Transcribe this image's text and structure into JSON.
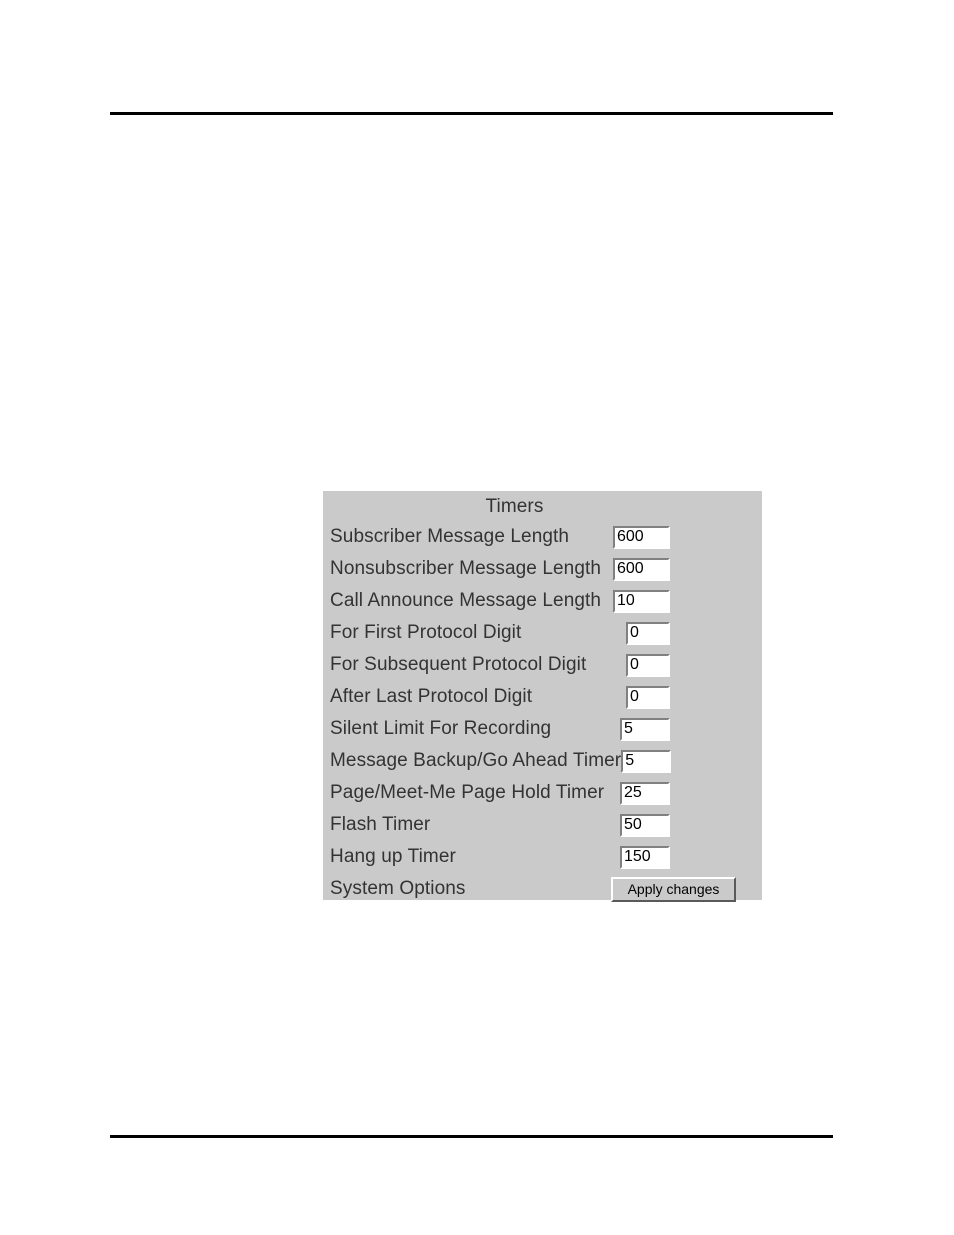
{
  "page": {
    "rules": {
      "top": true,
      "bottom": true
    }
  },
  "panel": {
    "title": "Timers",
    "rows": [
      {
        "label": "Subscriber Message Length",
        "value": "600",
        "width": "wide"
      },
      {
        "label": "Nonsubscriber Message Length",
        "value": "600",
        "width": "wide"
      },
      {
        "label": "Call Announce Message Length",
        "value": "10",
        "width": "wide"
      },
      {
        "label": "For First Protocol Digit",
        "value": "0",
        "width": "narrow"
      },
      {
        "label": "For Subsequent Protocol Digit",
        "value": "0",
        "width": "narrow"
      },
      {
        "label": "After Last Protocol Digit",
        "value": "0",
        "width": "narrow"
      },
      {
        "label": "Silent Limit For Recording",
        "value": "5",
        "width": "mid"
      },
      {
        "label": "Message Backup/Go Ahead Timer",
        "value": "5",
        "width": "mid"
      },
      {
        "label": "Page/Meet-Me Page Hold Timer",
        "value": "25",
        "width": "mid"
      },
      {
        "label": "Flash Timer",
        "value": "50",
        "width": "mid"
      },
      {
        "label": "Hang up Timer",
        "value": "150",
        "width": "mid"
      }
    ],
    "apply_row": {
      "label": "System Options",
      "button_label": "Apply changes"
    }
  },
  "colors": {
    "panel_background": "#cacaca",
    "text": "#333333",
    "field_background": "#ffffff",
    "bevel_shadow": "#808080",
    "bevel_highlight": "#ffffff",
    "rule": "#000000"
  }
}
